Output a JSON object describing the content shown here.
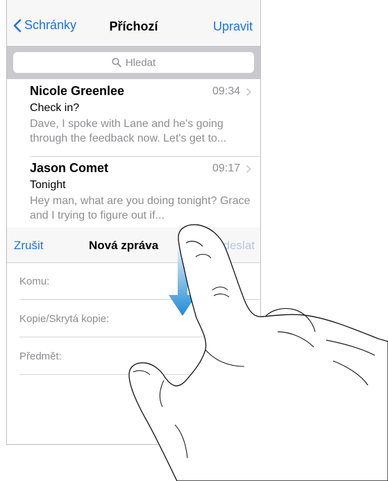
{
  "inbox": {
    "back_label": "Schránky",
    "title": "Příchozí",
    "edit_label": "Upravit",
    "search_placeholder": "Hledat",
    "messages": [
      {
        "sender": "Nicole Greenlee",
        "time": "09:34",
        "subject": "Check in?",
        "preview": "Dave, I spoke with Lane and he's going through the feedback now. Let's get to..."
      },
      {
        "sender": "Jason Comet",
        "time": "09:17",
        "subject": "Tonight",
        "preview": "Hey man, what are you doing tonight? Grace and I trying to figure out if..."
      }
    ]
  },
  "compose": {
    "cancel_label": "Zrušit",
    "title": "Nová zpráva",
    "send_label": "Odeslat",
    "fields": {
      "to": "Komu:",
      "cc_bcc": "Kopie/Skrytá kopie:",
      "subject": "Předmět:"
    }
  },
  "colors": {
    "accent": "#1a73e8",
    "secondary_text": "#8e8e93",
    "arrow_top": "#e6f2fb",
    "arrow_bottom": "#1f8bd6"
  }
}
